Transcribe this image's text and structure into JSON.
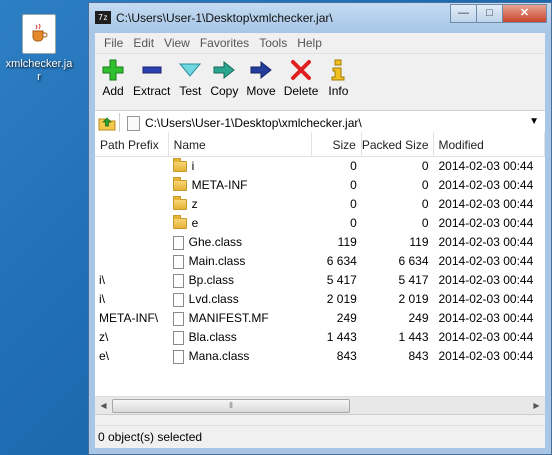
{
  "desktop": {
    "icon_label": "xmlchecker.jar"
  },
  "window": {
    "title": "C:\\Users\\User-1\\Desktop\\xmlchecker.jar\\",
    "app_icon_text": "7z",
    "controls": {
      "minimize": "—",
      "maximize": "□",
      "close": "✕"
    }
  },
  "menu": [
    "File",
    "Edit",
    "View",
    "Favorites",
    "Tools",
    "Help"
  ],
  "toolbar": {
    "add": "Add",
    "extract": "Extract",
    "test": "Test",
    "copy": "Copy",
    "move": "Move",
    "delete": "Delete",
    "info": "Info"
  },
  "address": {
    "path": "C:\\Users\\User-1\\Desktop\\xmlchecker.jar\\"
  },
  "columns": {
    "prefix": "Path Prefix",
    "name": "Name",
    "size": "Size",
    "packed": "Packed Size",
    "modified": "Modified"
  },
  "rows": [
    {
      "prefix": "",
      "name": "i",
      "type": "folder",
      "size": "0",
      "packed": "0",
      "modified": "2014-02-03 00:44"
    },
    {
      "prefix": "",
      "name": "META-INF",
      "type": "folder",
      "size": "0",
      "packed": "0",
      "modified": "2014-02-03 00:44"
    },
    {
      "prefix": "",
      "name": "z",
      "type": "folder",
      "size": "0",
      "packed": "0",
      "modified": "2014-02-03 00:44"
    },
    {
      "prefix": "",
      "name": "e",
      "type": "folder",
      "size": "0",
      "packed": "0",
      "modified": "2014-02-03 00:44"
    },
    {
      "prefix": "",
      "name": "Ghe.class",
      "type": "file",
      "size": "119",
      "packed": "119",
      "modified": "2014-02-03 00:44"
    },
    {
      "prefix": "",
      "name": "Main.class",
      "type": "file",
      "size": "6 634",
      "packed": "6 634",
      "modified": "2014-02-03 00:44"
    },
    {
      "prefix": "i\\",
      "name": "Bp.class",
      "type": "file",
      "size": "5 417",
      "packed": "5 417",
      "modified": "2014-02-03 00:44"
    },
    {
      "prefix": "i\\",
      "name": "Lvd.class",
      "type": "file",
      "size": "2 019",
      "packed": "2 019",
      "modified": "2014-02-03 00:44"
    },
    {
      "prefix": "META-INF\\",
      "name": "MANIFEST.MF",
      "type": "file",
      "size": "249",
      "packed": "249",
      "modified": "2014-02-03 00:44"
    },
    {
      "prefix": "z\\",
      "name": "Bla.class",
      "type": "file",
      "size": "1 443",
      "packed": "1 443",
      "modified": "2014-02-03 00:44"
    },
    {
      "prefix": "e\\",
      "name": "Mana.class",
      "type": "file",
      "size": "843",
      "packed": "843",
      "modified": "2014-02-03 00:44"
    }
  ],
  "status": "0 object(s) selected"
}
